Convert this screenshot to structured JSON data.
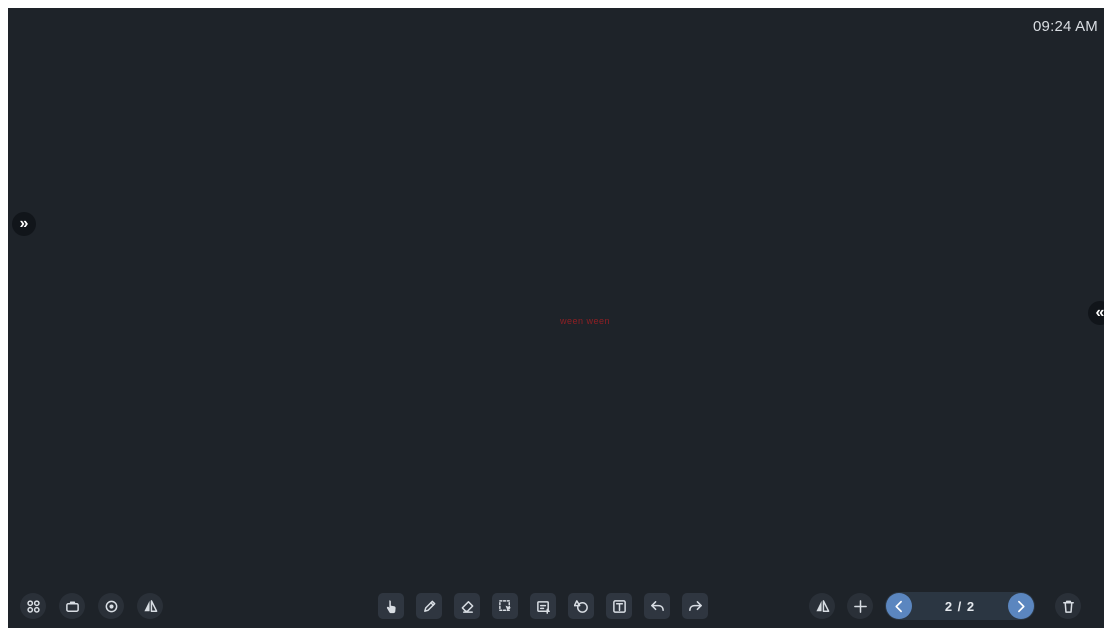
{
  "status_bar": {
    "clock": "09:24 AM"
  },
  "canvas": {
    "center_text": "ween ween"
  },
  "side_handles": {
    "left_glyph": "»",
    "right_glyph": "«"
  },
  "left_toolbar": {
    "items": [
      {
        "icon": "apps-grid-icon"
      },
      {
        "icon": "toolbox-icon"
      },
      {
        "icon": "browser-icon"
      },
      {
        "icon": "mirror-icon"
      }
    ]
  },
  "main_toolbar": {
    "items": [
      {
        "icon": "hand-pointer-icon",
        "active": true
      },
      {
        "icon": "pen-icon"
      },
      {
        "icon": "eraser-icon"
      },
      {
        "icon": "selection-icon"
      },
      {
        "icon": "insert-icon"
      },
      {
        "icon": "shape-icon"
      },
      {
        "icon": "text-icon"
      },
      {
        "icon": "undo-icon"
      },
      {
        "icon": "redo-icon"
      }
    ]
  },
  "right_toolbar": {
    "items": [
      {
        "icon": "mirror-icon"
      },
      {
        "icon": "add-page-icon"
      }
    ],
    "pager": {
      "page_indicator": "2 / 2",
      "current": 2,
      "total": 2
    },
    "delete": {
      "icon": "trash-icon"
    }
  },
  "colors": {
    "background": "#1e2329",
    "accent": "#5b86bf",
    "center_text": "#8f1f24"
  }
}
